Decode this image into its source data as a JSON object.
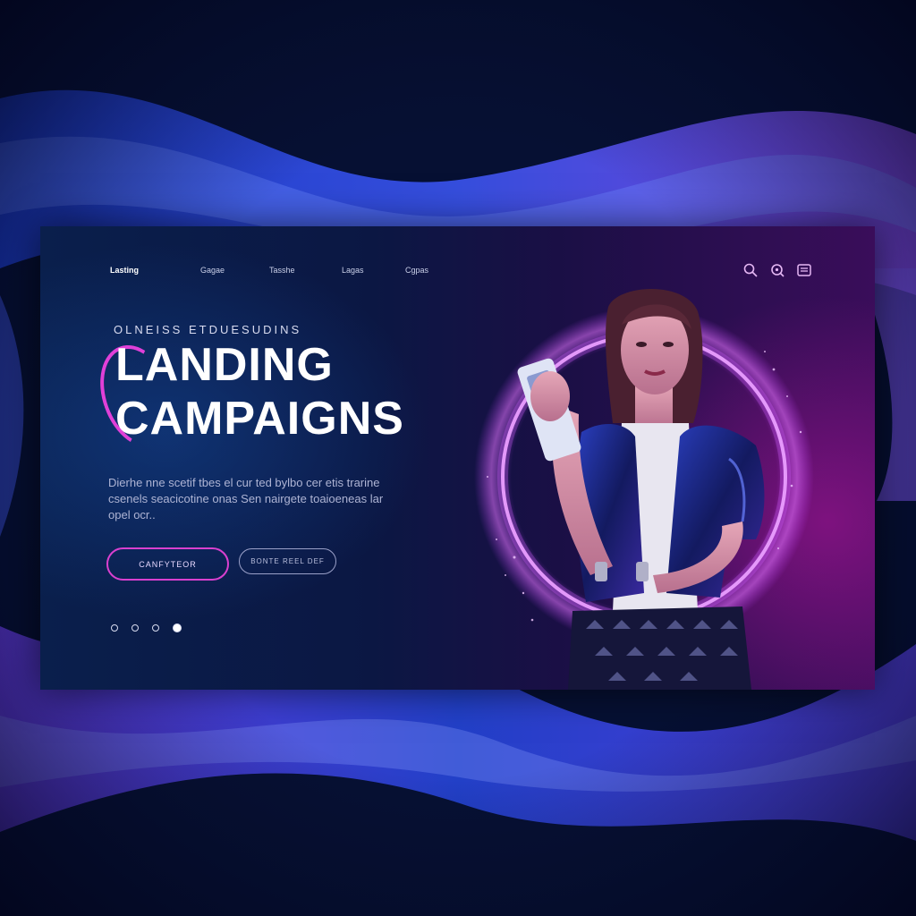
{
  "nav": {
    "items": [
      {
        "label": "Lasting",
        "active": true
      },
      {
        "label": "Gagae",
        "active": false
      },
      {
        "label": "Tasshe",
        "active": false
      },
      {
        "label": "Lagas",
        "active": false
      },
      {
        "label": "Cgpas",
        "active": false
      }
    ]
  },
  "header_icons": [
    "search-icon",
    "zoom-icon",
    "menu-icon"
  ],
  "hero": {
    "eyebrow": "OLNEISS  ETDUESUDINS",
    "title_line1": "LANDING",
    "title_line2": "CAMPAIGNS",
    "body": "Dierhe nne scetif tbes el cur ted bylbo cer etis trarine csenels seacicotine onas Sen nairgete toaioeneas lar opel ocr.."
  },
  "buttons": {
    "primary_label": "CANFYTEOR",
    "secondary_label": "BONTE REEL DEF"
  },
  "carousel": {
    "count": 4,
    "active_index": 3
  },
  "colors": {
    "accent": "#e040d8",
    "background": "#050a24",
    "panel_left": "#0a1f4c",
    "panel_right": "#3a0d5a",
    "ring": "#f4b8ff"
  }
}
